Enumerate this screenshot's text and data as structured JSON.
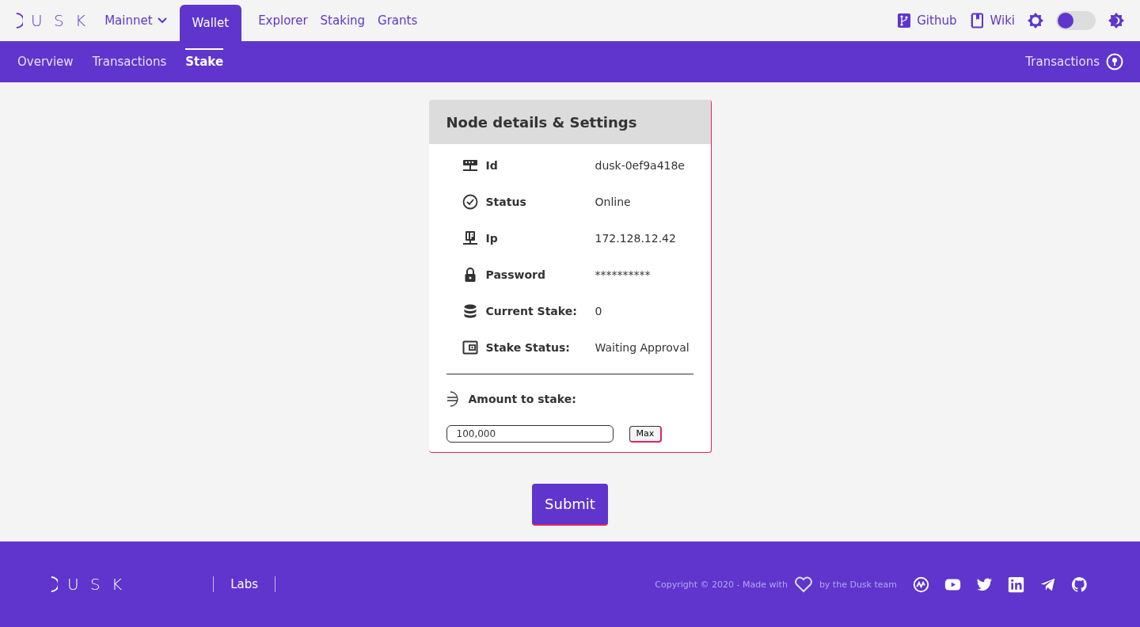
{
  "header": {
    "logo": "U S K",
    "network": "Mainnet",
    "tabs": [
      {
        "label": "Wallet",
        "selected": true
      },
      {
        "label": "Explorer",
        "selected": false
      },
      {
        "label": "Staking",
        "selected": false
      },
      {
        "label": "Grants",
        "selected": false
      }
    ],
    "links": [
      {
        "label": "Github",
        "kind": "github"
      },
      {
        "label": "Wiki",
        "kind": "wiki"
      }
    ],
    "dark_mode": false
  },
  "subnav": {
    "tabs": [
      {
        "label": "Overview",
        "selected": false
      },
      {
        "label": "Transactions",
        "selected": false
      },
      {
        "label": "Stake",
        "selected": true
      }
    ],
    "help": "Transactions"
  },
  "card": {
    "title": "Node details & Settings",
    "rows": [
      {
        "label": "Id",
        "value": "dusk-0ef9a418e"
      },
      {
        "label": "Status",
        "value": "Online"
      },
      {
        "label": "Ip",
        "value": "172.128.12.42"
      },
      {
        "label": "Password",
        "value": "**********"
      },
      {
        "label": "Current Stake:",
        "value": "0"
      },
      {
        "label": "Stake Status:",
        "value": "Waiting Approval"
      }
    ],
    "amount_label": "Amount to stake:",
    "amount": "100,000",
    "max": "Max"
  },
  "submit": "Submit",
  "footer": {
    "logo": "U S K",
    "labs": "Labs",
    "copyright": "Copyright © 2020  - Made with",
    "team": "by the Dusk team"
  }
}
